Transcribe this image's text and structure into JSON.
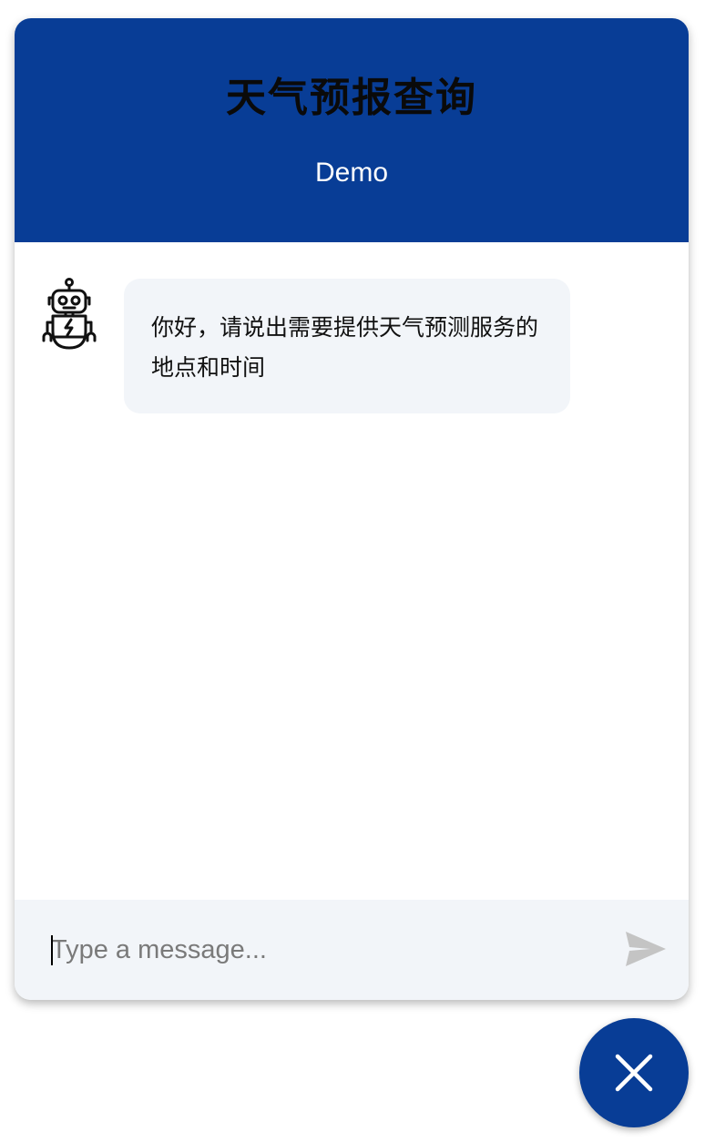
{
  "header": {
    "title": "天气预报查询",
    "subtitle": "Demo"
  },
  "messages": [
    {
      "sender": "bot",
      "avatar_icon": "robot-icon",
      "text": "你好，请说出需要提供天气预测服务的地点和时间"
    }
  ],
  "composer": {
    "placeholder": "Type a message...",
    "value": "",
    "send_icon": "send-icon"
  },
  "launcher": {
    "icon": "close-icon"
  },
  "colors": {
    "brand": "#083d96",
    "bubble_background": "#f2f5f9",
    "send_icon": "#c4c4c4",
    "subtitle_text": "#ffffff"
  }
}
